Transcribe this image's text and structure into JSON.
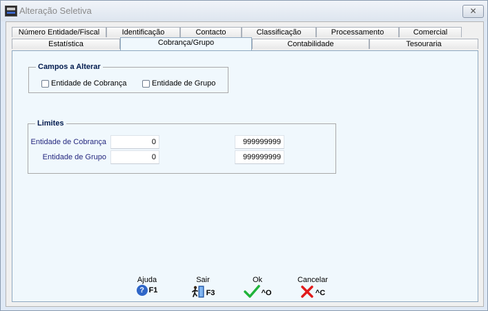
{
  "window": {
    "title": "Alteração Seletiva",
    "close_label": "✕"
  },
  "tabs": {
    "row1": [
      "Número Entidade/Fiscal",
      "Identificação",
      "Contacto",
      "Classificação",
      "Processamento",
      "Comercial"
    ],
    "row2": [
      "Estatística",
      "Cobrança/Grupo",
      "Contabilidade",
      "Tesouraria"
    ],
    "active": "Cobrança/Grupo"
  },
  "campos": {
    "legend": "Campos a Alterar",
    "options": [
      {
        "label": "Entidade de Cobrança",
        "checked": false
      },
      {
        "label": "Entidade de Grupo",
        "checked": false
      }
    ]
  },
  "limites": {
    "legend": "Limites",
    "rows": [
      {
        "label": "Entidade de Cobrança",
        "from": "0",
        "to": "999999999"
      },
      {
        "label": "Entidade de Grupo",
        "from": "0",
        "to": "999999999"
      }
    ]
  },
  "buttons": {
    "ajuda": {
      "label": "Ajuda",
      "key": "F1",
      "icon": "help-icon"
    },
    "sair": {
      "label": "Sair",
      "key": "F3",
      "icon": "exit-icon"
    },
    "ok": {
      "label": "Ok",
      "key": "^O",
      "icon": "check-icon"
    },
    "cancelar": {
      "label": "Cancelar",
      "key": "^C",
      "icon": "cancel-icon"
    }
  }
}
